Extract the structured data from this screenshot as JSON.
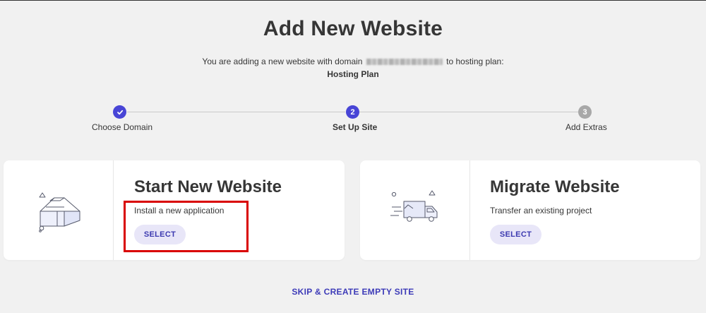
{
  "page": {
    "title": "Add New Website"
  },
  "subtitle": {
    "prefix": "You are adding a new website with domain",
    "suffix": "to hosting plan:",
    "plan_name": "Hosting Plan"
  },
  "stepper": {
    "steps": [
      {
        "number": "",
        "label": "Choose Domain",
        "state": "completed"
      },
      {
        "number": "2",
        "label": "Set Up Site",
        "state": "active"
      },
      {
        "number": "3",
        "label": "Add Extras",
        "state": "upcoming"
      }
    ],
    "colors": {
      "active": "#4845d6",
      "upcoming": "#a8a8a8",
      "line": "#c9c9c9"
    }
  },
  "cards": [
    {
      "title": "Start New Website",
      "description": "Install a new application",
      "button_label": "SELECT",
      "icon": "house-box-icon"
    },
    {
      "title": "Migrate Website",
      "description": "Transfer an existing project",
      "button_label": "SELECT",
      "icon": "delivery-truck-icon"
    }
  ],
  "skip_label": "SKIP & CREATE EMPTY SITE",
  "accent_color": "#3d3bb8",
  "highlight_color": "#d90000"
}
